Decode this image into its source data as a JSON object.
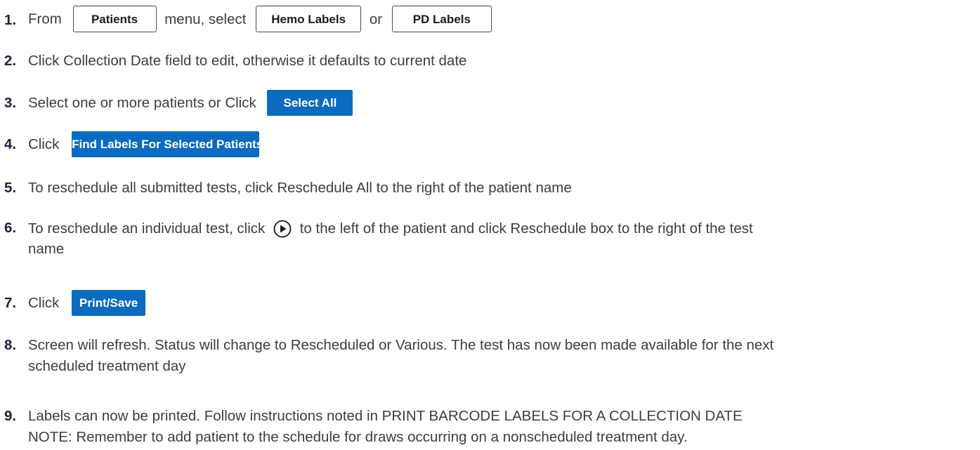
{
  "steps": [
    {
      "num": "1.",
      "text_a": "From",
      "btn_patients": "Patients",
      "text_b": "menu, select",
      "btn_hemo": "Hemo Labels",
      "text_c": "or",
      "btn_pd": "PD Labels"
    },
    {
      "num": "2.",
      "text": "Click Collection Date field to edit, otherwise it defaults to current date"
    },
    {
      "num": "3.",
      "text": "Select one or more patients or Click",
      "btn": "Select All"
    },
    {
      "num": "4.",
      "text": "Click",
      "btn": "Find Labels For Selected Patients"
    },
    {
      "num": "5.",
      "text": "To reschedule all submitted tests, click Reschedule All to the right of the patient name"
    },
    {
      "num": "6.",
      "text_a": "To reschedule an individual test, click",
      "icon": "play-circle-icon",
      "text_b": "to the left of the patient and click Reschedule box to the right of the test",
      "text_c": "name"
    },
    {
      "num": "7.",
      "text": "Click",
      "btn": "Print/Save"
    },
    {
      "num": "8.",
      "line1": "Screen will refresh.  Status will change to Rescheduled or Various. The test has now been made available for the next",
      "line2": "scheduled treatment day"
    },
    {
      "num": "9.",
      "line1": "Labels can now be printed.  Follow instructions noted in PRINT BARCODE LABELS FOR A  COLLECTION DATE",
      "line2": "NOTE: Remember to add patient to the schedule for draws occurring on a nonscheduled treatment day."
    }
  ],
  "colors": {
    "accent_blue": "#0b6bbf",
    "text": "#3d3d3d",
    "step_number": "#1f1f3f"
  }
}
